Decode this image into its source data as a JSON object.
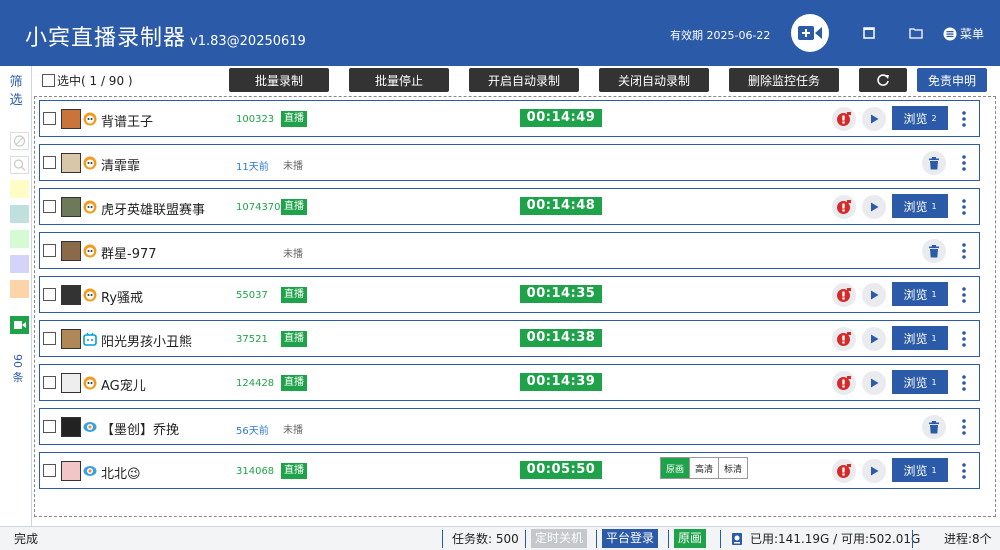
{
  "header": {
    "title": "小宾直播录制器",
    "version": "v1.83@20250619",
    "expiry": "有效期 2025-06-22",
    "menu_label": "菜单"
  },
  "sidebar": {
    "filter_label": "筛选",
    "count_label": "90 条",
    "swatch_colors": [
      "#fffcc6",
      "#bfe0dc",
      "#d4fbd3",
      "#d4d4fb",
      "#fbd4a8"
    ]
  },
  "toolbar": {
    "select_all": "选中( 1  /  90 )",
    "buttons": [
      "批量录制",
      "批量停止",
      "开启自动录制",
      "关闭自动录制",
      "删除监控任务"
    ],
    "disclaimer": "免责申明"
  },
  "rows": [
    {
      "name": "背谱王子",
      "viewers": "100323",
      "status": "直播",
      "timer": "00:14:49",
      "browse": "浏览",
      "count": "2",
      "platform": "huya"
    },
    {
      "name": "清霏霏",
      "viewers": "11天前",
      "status": "未播",
      "platform": "huya"
    },
    {
      "name": "虎牙英雄联盟赛事",
      "viewers": "1074370",
      "status": "直播",
      "timer": "00:14:48",
      "browse": "浏览",
      "count": "1",
      "platform": "huya"
    },
    {
      "name": "群星-977",
      "viewers": "",
      "status": "未播",
      "platform": "huya"
    },
    {
      "name": "Ry骚戒",
      "viewers": "55037",
      "status": "直播",
      "timer": "00:14:35",
      "browse": "浏览",
      "count": "1",
      "platform": "huya"
    },
    {
      "name": "阳光男孩小丑熊",
      "viewers": "37521",
      "status": "直播",
      "timer": "00:14:38",
      "browse": "浏览",
      "count": "1",
      "platform": "bilibili"
    },
    {
      "name": "AG宠儿",
      "viewers": "124428",
      "status": "直播",
      "timer": "00:14:39",
      "browse": "浏览",
      "count": "1",
      "platform": "huya"
    },
    {
      "name": "【墨创】乔挽",
      "viewers": "56天前",
      "status": "未播",
      "platform": "douyu"
    },
    {
      "name": "北北😉",
      "viewers": "314068",
      "status": "直播",
      "timer": "00:05:50",
      "browse": "浏览",
      "count": "1",
      "platform": "douyu"
    }
  ],
  "quality_options": [
    "原画",
    "高清",
    "标清"
  ],
  "statusbar": {
    "status": "完成",
    "tasks": "任务数: 500",
    "timer_shutdown": "定时关机",
    "platform_login": "平台登录",
    "quality": "原画",
    "disk": "已用:141.19G / 可用:502.01G",
    "processes": "进程:8个"
  },
  "colors": {
    "brand": "#2b5aa8",
    "live_green": "#1fa34a",
    "record_red": "#d42a2a"
  }
}
